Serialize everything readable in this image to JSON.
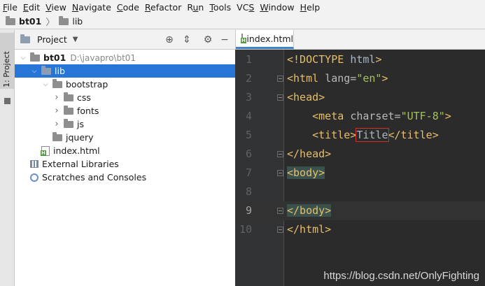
{
  "menu": [
    {
      "label": "File",
      "mnemonic": "F"
    },
    {
      "label": "Edit",
      "mnemonic": "E"
    },
    {
      "label": "View",
      "mnemonic": "V"
    },
    {
      "label": "Navigate",
      "mnemonic": "N"
    },
    {
      "label": "Code",
      "mnemonic": "C"
    },
    {
      "label": "Refactor",
      "mnemonic": "R"
    },
    {
      "label": "Run",
      "mnemonic": "u"
    },
    {
      "label": "Tools",
      "mnemonic": "T"
    },
    {
      "label": "VCS",
      "mnemonic": "S"
    },
    {
      "label": "Window",
      "mnemonic": "W"
    },
    {
      "label": "Help",
      "mnemonic": "H"
    }
  ],
  "breadcrumb": [
    "bt01",
    "lib"
  ],
  "stripe": {
    "label": "1: Project"
  },
  "project_panel": {
    "title": "Project",
    "tree": [
      {
        "label": "bt01",
        "path": "D:\\javapro\\bt01",
        "type": "folder",
        "expanded": true
      },
      {
        "label": "lib",
        "type": "folder",
        "expanded": true,
        "selected": true
      },
      {
        "label": "bootstrap",
        "type": "folder",
        "expanded": true
      },
      {
        "label": "css",
        "type": "folder",
        "expanded": false
      },
      {
        "label": "fonts",
        "type": "folder",
        "expanded": false
      },
      {
        "label": "js",
        "type": "folder",
        "expanded": false
      },
      {
        "label": "jquery",
        "type": "folder",
        "expanded": false
      },
      {
        "label": "index.html",
        "type": "html-file"
      },
      {
        "label": "External Libraries",
        "type": "library"
      },
      {
        "label": "Scratches and Consoles",
        "type": "scratch"
      }
    ]
  },
  "editor": {
    "tab_label": "index.html",
    "lines": [
      {
        "number": "1",
        "tokens": [
          [
            "tag",
            "<!DOCTYPE "
          ],
          [
            "txt",
            "html"
          ],
          [
            "tag",
            ">"
          ]
        ]
      },
      {
        "number": "2",
        "tokens": [
          [
            "tag",
            "<html "
          ],
          [
            "attr",
            "lang="
          ],
          [
            "val",
            "\"en\""
          ],
          [
            "tag",
            ">"
          ]
        ]
      },
      {
        "number": "3",
        "tokens": [
          [
            "tag",
            "<head>"
          ]
        ]
      },
      {
        "number": "4",
        "tokens": [
          [
            "txt",
            "    "
          ],
          [
            "tag",
            "<meta "
          ],
          [
            "attr",
            "charset="
          ],
          [
            "val",
            "\"UTF-8\""
          ],
          [
            "tag",
            ">"
          ]
        ]
      },
      {
        "number": "5",
        "tokens": [
          [
            "txt",
            "    "
          ],
          [
            "tag",
            "<title>"
          ],
          [
            "boxed",
            "Title"
          ],
          [
            "tag",
            "</title>"
          ]
        ]
      },
      {
        "number": "6",
        "tokens": [
          [
            "tag",
            "</head>"
          ]
        ]
      },
      {
        "number": "7",
        "tokens": [
          [
            "hltag",
            "<body>"
          ]
        ]
      },
      {
        "number": "8",
        "tokens": []
      },
      {
        "number": "9",
        "tokens": [
          [
            "hltag",
            "</body>"
          ]
        ]
      },
      {
        "number": "10",
        "tokens": [
          [
            "tag",
            "</html>"
          ]
        ]
      }
    ],
    "current_line": "9"
  },
  "watermark": "https://blog.csdn.net/OnlyFighting"
}
